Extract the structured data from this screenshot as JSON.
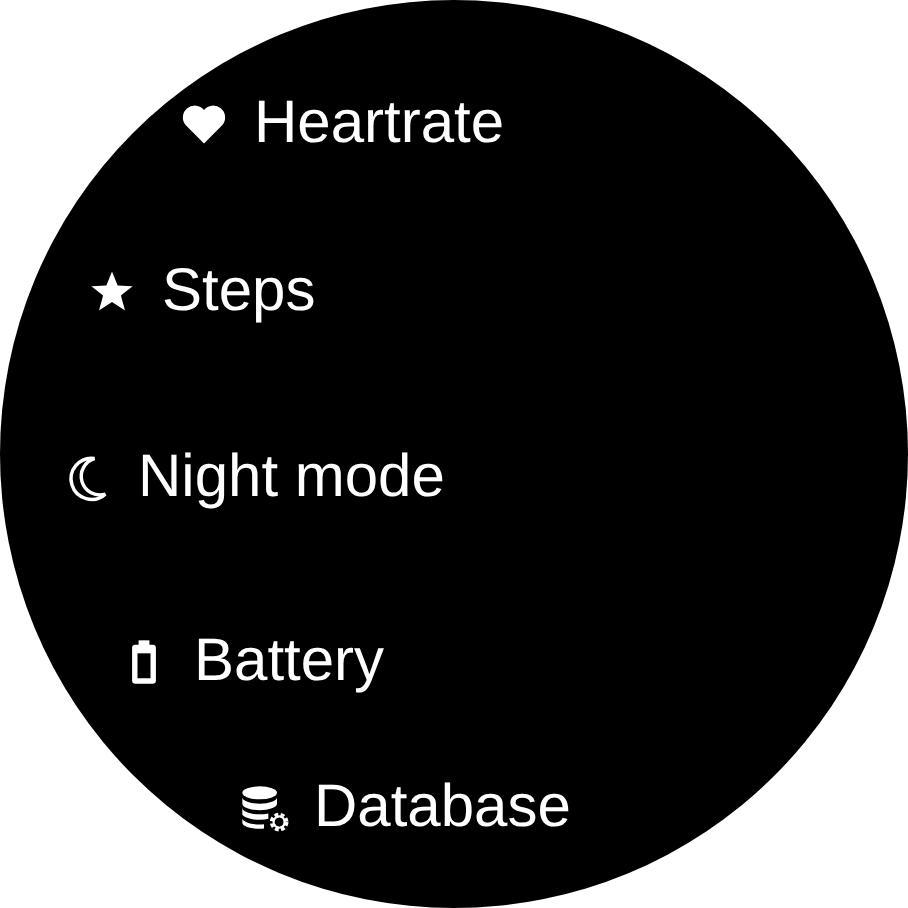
{
  "menu": {
    "items": [
      {
        "kind": "heart",
        "label": "Heartrate"
      },
      {
        "kind": "star",
        "label": "Steps"
      },
      {
        "kind": "moon",
        "label": "Night mode"
      },
      {
        "kind": "battery",
        "label": "Battery"
      },
      {
        "kind": "database",
        "label": "Database"
      }
    ]
  }
}
